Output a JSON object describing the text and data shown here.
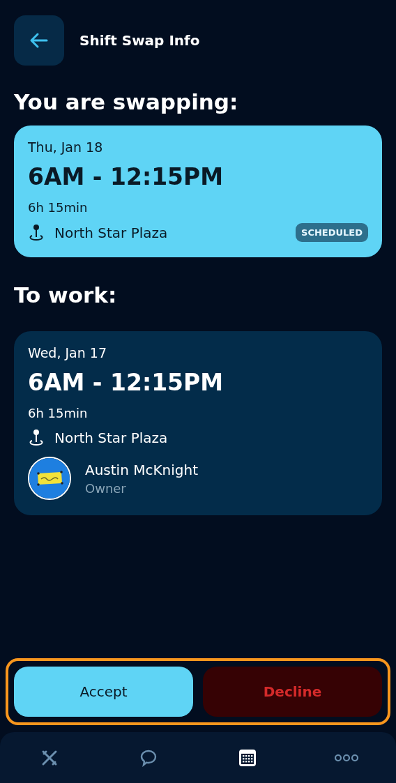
{
  "header": {
    "title": "Shift Swap Info"
  },
  "sections": [
    {
      "heading": "You are swapping:",
      "shift": {
        "kind": "current",
        "date": "Thu, Jan 18",
        "time": "6AM - 12:15PM",
        "duration": "6h 15min",
        "location": "North Star Plaza",
        "status": "SCHEDULED"
      }
    },
    {
      "heading": "To work:",
      "shift": {
        "kind": "offered",
        "date": "Wed, Jan 17",
        "time": "6AM - 12:15PM",
        "duration": "6h 15min",
        "location": "North Star Plaza",
        "person": {
          "name": "Austin McKnight",
          "role": "Owner"
        }
      }
    }
  ],
  "actions": {
    "highlighted": true,
    "buttons": [
      {
        "kind": "accept",
        "label": "Accept"
      },
      {
        "kind": "decline",
        "label": "Decline"
      }
    ]
  },
  "nav": [
    {
      "kind": "tools",
      "selected": false
    },
    {
      "kind": "chat",
      "selected": false
    },
    {
      "kind": "calendar",
      "selected": true
    },
    {
      "kind": "more",
      "selected": false
    }
  ]
}
